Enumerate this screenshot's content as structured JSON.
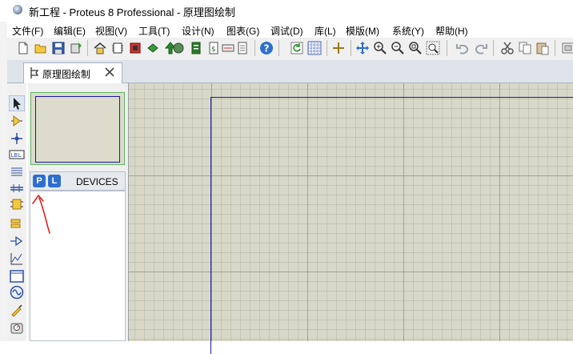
{
  "window": {
    "title": "新工程 - Proteus 8 Professional - 原理图绘制"
  },
  "menu": [
    {
      "label": "文件(F)"
    },
    {
      "label": "编辑(E)"
    },
    {
      "label": "视图(V)"
    },
    {
      "label": "工具(T)"
    },
    {
      "label": "设计(N)"
    },
    {
      "label": "图表(G)"
    },
    {
      "label": "调试(D)"
    },
    {
      "label": "库(L)"
    },
    {
      "label": "模版(M)"
    },
    {
      "label": "系统(Y)"
    },
    {
      "label": "帮助(H)"
    }
  ],
  "tab": {
    "label": "原理图绘制"
  },
  "devices": {
    "p_label": "P",
    "l_label": "L",
    "header": "DEVICES"
  },
  "colors": {
    "grid_bg": "#d8d8c8",
    "sheet_border": "#1a1a9c",
    "accent_blue": "#2d6fcf",
    "annotation_red": "#e02020"
  }
}
